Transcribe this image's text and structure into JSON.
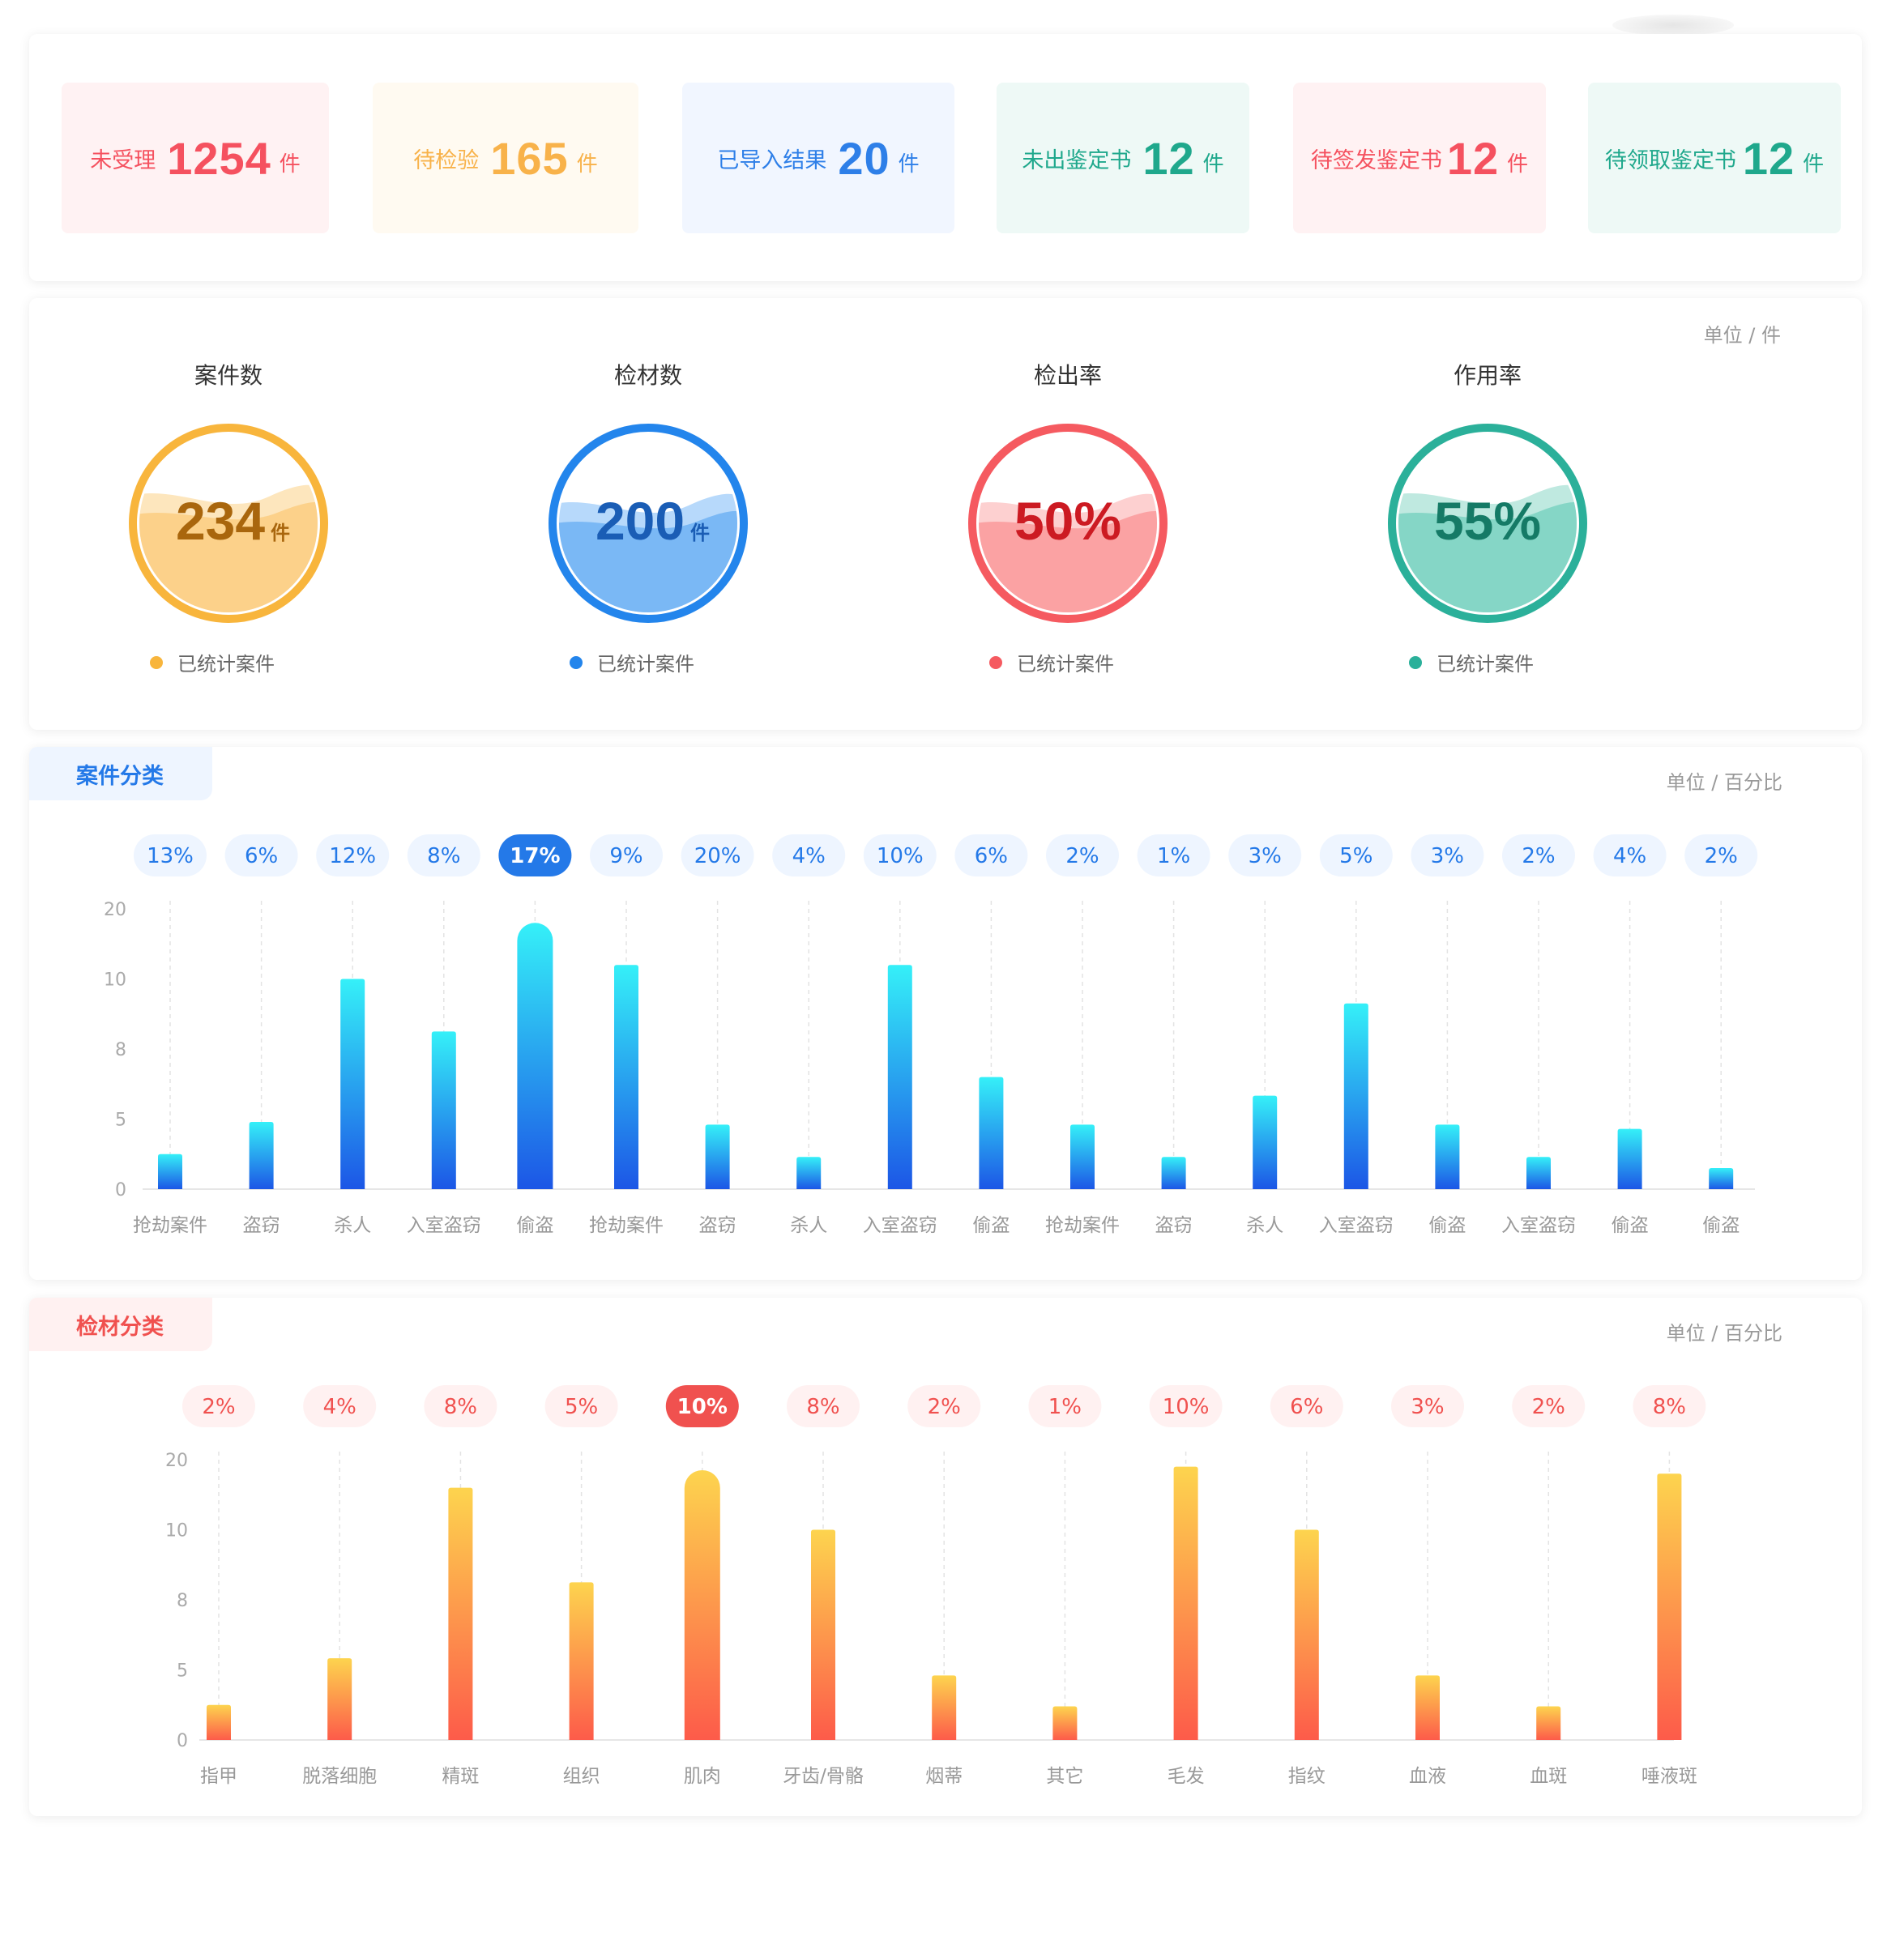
{
  "stats": [
    {
      "label": "未受理",
      "value": "1254",
      "unit": "件",
      "color": "#f5515f",
      "bg": "#fff2f3"
    },
    {
      "label": "待检验",
      "value": "165",
      "unit": "件",
      "color": "#f8b24a",
      "bg": "#fffaf1"
    },
    {
      "label": "已导入结果",
      "value": "20",
      "unit": "件",
      "color": "#2e7fe8",
      "bg": "#f1f6ff"
    },
    {
      "label": "未出鉴定书",
      "value": "12",
      "unit": "件",
      "color": "#1fa88c",
      "bg": "#eef9f6"
    },
    {
      "label": "待签发鉴定书",
      "value": "12",
      "unit": "件",
      "color": "#f5515f",
      "bg": "#fff2f3"
    },
    {
      "label": "待领取鉴定书",
      "value": "12",
      "unit": "件",
      "color": "#1fa88c",
      "bg": "#eef9f6"
    }
  ],
  "gauges": {
    "unit_note": "单位 / 件",
    "items": [
      {
        "title": "案件数",
        "value": "234",
        "unit": "件",
        "legend": "已统计案件",
        "fill_level": 0.55,
        "ring": "#f8b53c",
        "fill": "#fcd18a",
        "fill_light": "#fde6bd",
        "text": "#a9660d"
      },
      {
        "title": "检材数",
        "value": "200",
        "unit": "件",
        "legend": "已统计案件",
        "fill_level": 0.5,
        "ring": "#2385ec",
        "fill": "#7ab8f5",
        "fill_light": "#b7d9fb",
        "text": "#1a5db5"
      },
      {
        "title": "检出率",
        "value": "50%",
        "unit": "",
        "legend": "已统计案件",
        "fill_level": 0.5,
        "ring": "#f55a60",
        "fill": "#fba2a3",
        "fill_light": "#fdd0d0",
        "text": "#cc1a22"
      },
      {
        "title": "作用率",
        "value": "55%",
        "unit": "",
        "legend": "已统计案件",
        "fill_level": 0.55,
        "ring": "#2bb09a",
        "fill": "#85d6c6",
        "fill_light": "#bfe9e0",
        "text": "#157a66"
      }
    ]
  },
  "cases": {
    "tag": "案件分类",
    "unit_note": "单位 / 百分比",
    "accent": "#2479e8",
    "chart_data": {
      "type": "bar",
      "categories": [
        "抢劫案件",
        "盗窃",
        "杀人",
        "入室盗窃",
        "偷盗",
        "抢劫案件",
        "盗窃",
        "杀人",
        "入室盗窃",
        "偷盗",
        "抢劫案件",
        "盗窃",
        "杀人",
        "入室盗窃",
        "偷盗",
        "入室盗窃",
        "偷盗",
        "偷盗"
      ],
      "percent_labels": [
        "13%",
        "6%",
        "12%",
        "8%",
        "17%",
        "9%",
        "20%",
        "4%",
        "10%",
        "6%",
        "2%",
        "1%",
        "3%",
        "5%",
        "3%",
        "2%",
        "4%",
        "2%"
      ],
      "highlight_index": 4,
      "values": [
        2.5,
        4.8,
        10,
        8.5,
        18,
        12,
        4.6,
        2.3,
        12,
        6.8,
        4.6,
        2.3,
        6,
        9.3,
        4.6,
        2.3,
        4.3,
        1.5
      ],
      "y_ticks": [
        "20",
        "10",
        "8",
        "5",
        "0"
      ],
      "tick_values": [
        20,
        10,
        8,
        5,
        0
      ],
      "colors": {
        "top": "#35f0f8",
        "bottom": "#1c56e6"
      }
    }
  },
  "materials": {
    "tag": "检材分类",
    "unit_note": "单位 / 百分比",
    "accent": "#f0514f",
    "chart_data": {
      "type": "bar",
      "categories": [
        "指甲",
        "脱落细胞",
        "精斑",
        "组织",
        "肌肉",
        "牙齿/骨骼",
        "烟蒂",
        "其它",
        "毛发",
        "指纹",
        "血液",
        "血斑",
        "唾液斑"
      ],
      "percent_labels": [
        "2%",
        "4%",
        "8%",
        "5%",
        "10%",
        "8%",
        "2%",
        "1%",
        "10%",
        "6%",
        "3%",
        "2%",
        "8%"
      ],
      "highlight_index": 4,
      "values": [
        2.5,
        5.5,
        16,
        8.5,
        18.5,
        10,
        4.6,
        2.4,
        19,
        10,
        4.6,
        2.4,
        18
      ],
      "y_ticks": [
        "20",
        "10",
        "8",
        "5",
        "0"
      ],
      "tick_values": [
        20,
        10,
        8,
        5,
        0
      ],
      "colors": {
        "top": "#fdd44e",
        "bottom": "#fd5b4a"
      }
    }
  }
}
